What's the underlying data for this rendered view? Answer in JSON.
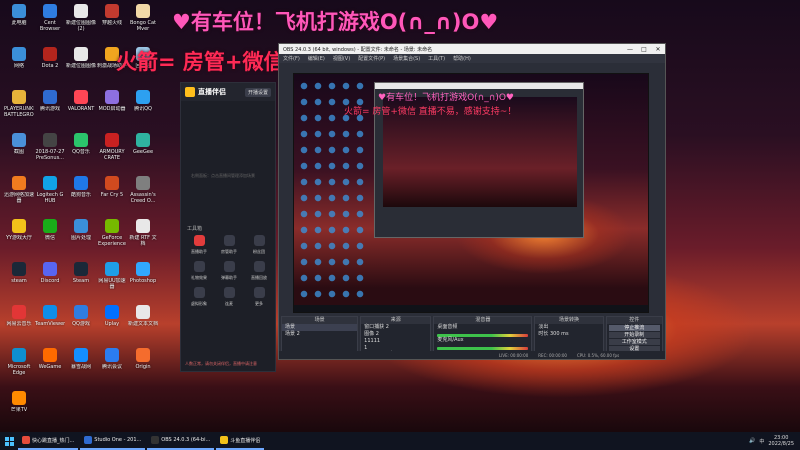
{
  "overlay": {
    "line1": "♥有车位！飞机打游戏O(∩_∩)O♥",
    "line2": "火箭= 房管+微信 直播不易，感谢支持~！"
  },
  "desktop_icons": [
    {
      "label": "此电脑",
      "color": "#3b8fd9"
    },
    {
      "label": "Cent Browser",
      "color": "#2f7de1"
    },
    {
      "label": "新建位图图像(2)",
      "color": "#e8e8e8"
    },
    {
      "label": "穿越火线",
      "color": "#c23a2f"
    },
    {
      "label": "Bongo Cat Mver",
      "color": "#f2d8a7"
    },
    {
      "label": "网络",
      "color": "#3b8fd9"
    },
    {
      "label": "Dota 2",
      "color": "#b3251d"
    },
    {
      "label": "新建位图图像",
      "color": "#e8e8e8"
    },
    {
      "label": "刺激战场助手",
      "color": "#f0a51f"
    },
    {
      "label": "回收站",
      "color": "#9cc7e6"
    },
    {
      "label": "PLAYERUNKNOWN'S BATTLEGROUNDS",
      "color": "#e7b33a"
    },
    {
      "label": "腾讯游戏",
      "color": "#2f6bd1"
    },
    {
      "label": "VALORANT",
      "color": "#ff4655"
    },
    {
      "label": "MOD启动器",
      "color": "#8d6fe0"
    },
    {
      "label": "腾讯QQ",
      "color": "#2da0f0"
    },
    {
      "label": "截图",
      "color": "#4a90d9"
    },
    {
      "label": "2018-07-27 PreSonus...",
      "color": "#444"
    },
    {
      "label": "QQ音乐",
      "color": "#2bc46b"
    },
    {
      "label": "ARMOURY CRATE",
      "color": "#c92121"
    },
    {
      "label": "GeeGee",
      "color": "#2fb3a0"
    },
    {
      "label": "迅游网络加速器",
      "color": "#f07b1f"
    },
    {
      "label": "Logitech G HUB",
      "color": "#11a3e6"
    },
    {
      "label": "酷狗音乐",
      "color": "#1f78e8"
    },
    {
      "label": "Far Cry 5",
      "color": "#d14a1f"
    },
    {
      "label": "Assassin's Creed O...",
      "color": "#7f7f7f"
    },
    {
      "label": "YY游戏大厅",
      "color": "#f2c21a"
    },
    {
      "label": "微信",
      "color": "#1aad19"
    },
    {
      "label": "图片处理",
      "color": "#3b8fd9"
    },
    {
      "label": "GeForce Experience",
      "color": "#76b900"
    },
    {
      "label": "新建 RTF 文档",
      "color": "#e8e8e8"
    },
    {
      "label": "steam",
      "color": "#1b2838"
    },
    {
      "label": "Discord",
      "color": "#5865f2"
    },
    {
      "label": "Steam",
      "color": "#1b2838"
    },
    {
      "label": "网易UU加速器",
      "color": "#1f9ee8"
    },
    {
      "label": "Photoshop",
      "color": "#31a8ff"
    },
    {
      "label": "网易云音乐",
      "color": "#e23636"
    },
    {
      "label": "TeamViewer",
      "color": "#0e8ee9"
    },
    {
      "label": "QQ游戏",
      "color": "#2f7de1"
    },
    {
      "label": "Uplay",
      "color": "#0070ff"
    },
    {
      "label": "新建文本文档",
      "color": "#e8e8e8"
    },
    {
      "label": "Microsoft Edge",
      "color": "#0f8fcf"
    },
    {
      "label": "WeGame",
      "color": "#ff6a00"
    },
    {
      "label": "暴雪战网",
      "color": "#148eff"
    },
    {
      "label": "腾讯会议",
      "color": "#2b7cf0"
    },
    {
      "label": "Origin",
      "color": "#f56c2d"
    },
    {
      "label": "芒果TV",
      "color": "#ff8a00"
    }
  ],
  "live_app": {
    "title": "直播伴侣",
    "top_button": "开播设置",
    "placeholder": "右侧面板：点击直播间管理添加场景",
    "tools_title": "工具箱",
    "tools": [
      {
        "label": "直播助手",
        "color": "#e23c3c"
      },
      {
        "label": "房管助手",
        "color": "#3a3d4a"
      },
      {
        "label": "粉丝团",
        "color": "#3a3d4a"
      },
      {
        "label": "礼物效果",
        "color": "#3a3d4a"
      },
      {
        "label": "弹幕助手",
        "color": "#3a3d4a"
      },
      {
        "label": "直播回放",
        "color": "#3a3d4a"
      },
      {
        "label": "虚拟形象",
        "color": "#3a3d4a"
      },
      {
        "label": "连麦",
        "color": "#3a3d4a"
      },
      {
        "label": "更多",
        "color": "#3a3d4a"
      }
    ],
    "status": "人数正常，请勿关闭伴侣，直播中请注意"
  },
  "obs": {
    "title": "OBS 24.0.3 (64 bit, windows) - 配置文件: 未命名 - 场景: 未命名",
    "menus": [
      "文件(F)",
      "编辑(E)",
      "视图(V)",
      "配置文件(P)",
      "场景集合(S)",
      "工具(T)",
      "帮助(H)"
    ],
    "controls": {
      "minimize": "—",
      "maximize": "□",
      "close": "✕"
    },
    "docks": {
      "scenes": {
        "title": "场景",
        "items": [
          "场景",
          "场景 2"
        ]
      },
      "sources": {
        "title": "来源",
        "items": [
          "窗口捕获 2",
          "图像 2",
          "11111",
          "1",
          "1"
        ]
      },
      "mixer": {
        "title": "混音器",
        "items": [
          "桌面音频",
          "麦克风/Aux"
        ]
      },
      "transitions": {
        "title": "场景转换",
        "type": "淡出",
        "duration_label": "时长",
        "duration_value": "300 ms"
      },
      "controls": {
        "title": "控件",
        "buttons": [
          "停止推流",
          "开始录制",
          "工作室模式",
          "设置",
          "退出"
        ]
      }
    },
    "statusbar": {
      "dropped": "LIVE: 00:00:00",
      "rec": "REC: 00:00:00",
      "cpu": "CPU: 0.5%, 60.00 fps"
    }
  },
  "taskbar": {
    "buttons": [
      {
        "label": "快心跳直播_热门...",
        "color": "#e64c3c"
      },
      {
        "label": "Studio One - 201...",
        "color": "#2f6bd1"
      },
      {
        "label": "OBS 24.0.3 (64-bi...",
        "color": "#333"
      },
      {
        "label": "斗鱼直播伴侣",
        "color": "#f2c21a"
      }
    ],
    "tray_lang": "中",
    "time": "23:00",
    "date": "2022/8/25"
  }
}
